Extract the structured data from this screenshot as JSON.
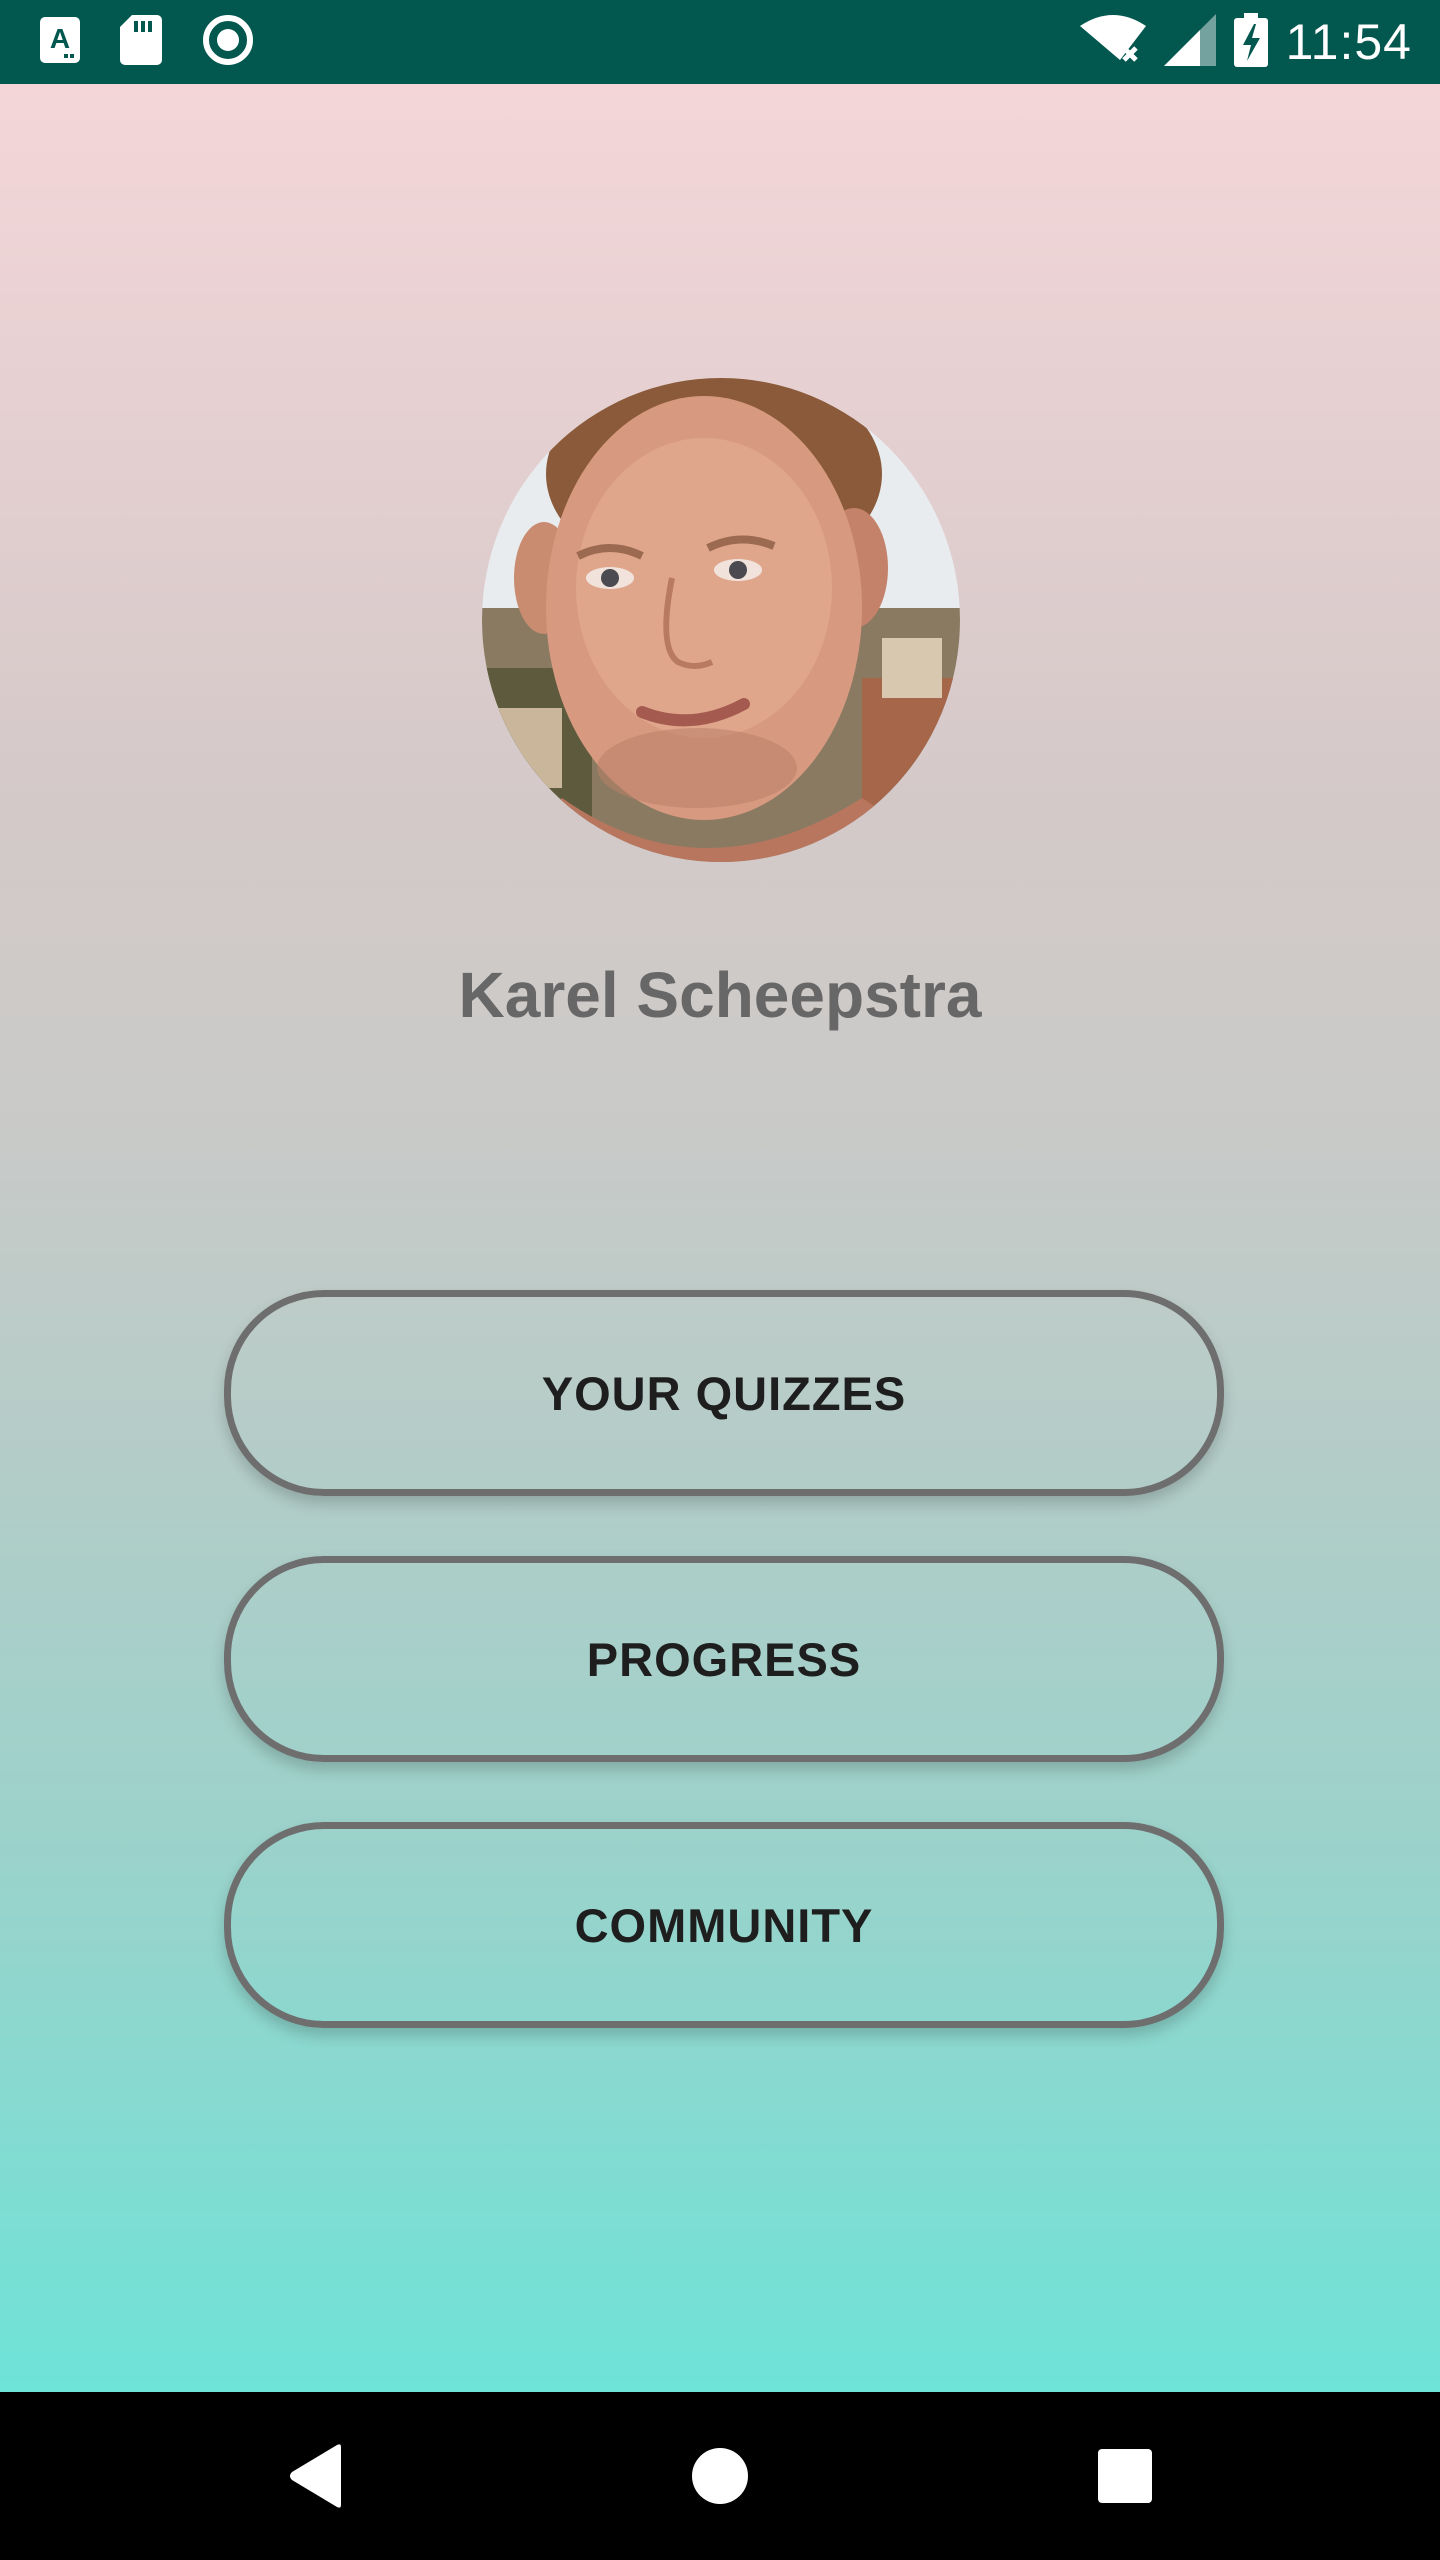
{
  "status_bar": {
    "time": "11:54",
    "left_icons": [
      "text-a-icon",
      "sd-card-icon",
      "record-icon"
    ],
    "right_icons": [
      "wifi-no-internet-icon",
      "cell-signal-icon",
      "battery-charging-icon"
    ],
    "background_color": "#02574f"
  },
  "profile": {
    "name": "Karel Scheepstra",
    "avatar_icon": "profile-photo"
  },
  "menu": {
    "buttons": [
      {
        "label": "YOUR QUIZZES"
      },
      {
        "label": "PROGRESS"
      },
      {
        "label": "COMMUNITY"
      }
    ]
  },
  "nav_bar": {
    "icons": [
      "back-icon",
      "home-icon",
      "recents-icon"
    ]
  },
  "colors": {
    "gradient_top": "#f4d6d8",
    "gradient_bottom": "#6ee3d8",
    "button_border": "#6e6e6e",
    "name_text": "#676767"
  }
}
